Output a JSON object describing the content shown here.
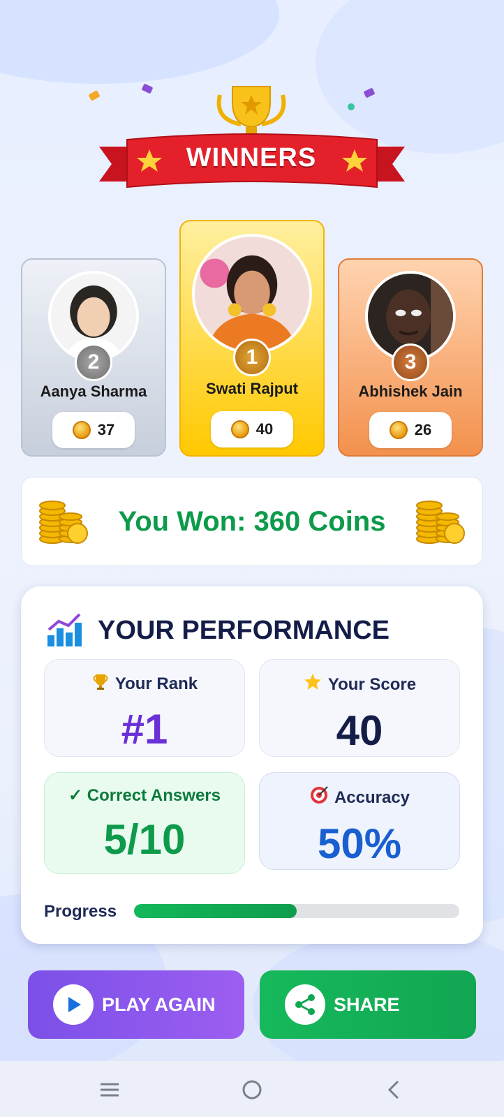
{
  "header": {
    "title": "WINNERS"
  },
  "podium": [
    {
      "rank": "2",
      "name": "Aanya Sharma",
      "coins": "37"
    },
    {
      "rank": "1",
      "name": "Swati Rajput",
      "coins": "40"
    },
    {
      "rank": "3",
      "name": "Abhishek Jain",
      "coins": "26"
    }
  ],
  "won": {
    "text": "You Won: 360 Coins"
  },
  "performance": {
    "title": "YOUR PERFORMANCE",
    "rank_label": "Your Rank",
    "rank_value": "#1",
    "score_label": "Your Score",
    "score_value": "40",
    "correct_label": "✓ Correct Answers",
    "correct_value": "5/10",
    "accuracy_label": "Accuracy",
    "accuracy_value": "50%",
    "progress_label": "Progress",
    "progress_fraction": 0.5
  },
  "buttons": {
    "play_again": "PLAY AGAIN",
    "share": "SHARE"
  },
  "colors": {
    "accent_purple": "#7b50e8",
    "accent_green": "#16b95c",
    "won_green": "#0d9a4b"
  },
  "icons": [
    "trophy-icon",
    "star-icon",
    "coin-icon",
    "chart-icon",
    "target-icon",
    "play-icon",
    "share-icon",
    "menu-icon",
    "home-icon",
    "back-icon"
  ]
}
